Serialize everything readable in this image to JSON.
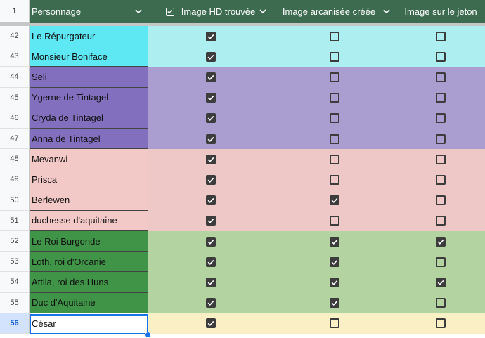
{
  "header": {
    "corner": "1",
    "columns": [
      {
        "label": "Personnage"
      },
      {
        "label": "Image HD trouvée"
      },
      {
        "label": "Image arcanisée créée"
      },
      {
        "label": "Image sur le jeton"
      }
    ]
  },
  "colors": {
    "header_bg": "#3d6b4f",
    "cyan": "#5ee8f3",
    "cyan_light": "#adeef1",
    "purple": "#8270bf",
    "purple_light": "#a99ecf",
    "pink": "#f3c9c8",
    "pink_light": "#eec8c7",
    "green": "#3f9447",
    "green_light": "#b3d3a0",
    "yellow": "#fff",
    "yellow_light": "#fbefc6"
  },
  "rows": [
    {
      "num": "42",
      "name": "Le Répurgateur",
      "group": "cyan",
      "hd": true,
      "arc": false,
      "jeton": false
    },
    {
      "num": "43",
      "name": "Monsieur Boniface",
      "group": "cyan",
      "hd": true,
      "arc": false,
      "jeton": false
    },
    {
      "num": "44",
      "name": "Seli",
      "group": "purple",
      "hd": true,
      "arc": false,
      "jeton": false
    },
    {
      "num": "45",
      "name": "Ygerne de Tintagel",
      "group": "purple",
      "hd": true,
      "arc": false,
      "jeton": false
    },
    {
      "num": "46",
      "name": "Cryda de Tintagel",
      "group": "purple",
      "hd": true,
      "arc": false,
      "jeton": false
    },
    {
      "num": "47",
      "name": "Anna de Tintagel",
      "group": "purple",
      "hd": true,
      "arc": false,
      "jeton": false
    },
    {
      "num": "48",
      "name": "Mevanwi",
      "group": "pink",
      "hd": true,
      "arc": false,
      "jeton": false
    },
    {
      "num": "49",
      "name": "Prisca",
      "group": "pink",
      "hd": true,
      "arc": false,
      "jeton": false
    },
    {
      "num": "50",
      "name": "Berlewen",
      "group": "pink",
      "hd": true,
      "arc": true,
      "jeton": false
    },
    {
      "num": "51",
      "name": "duchesse d'aquitaine",
      "group": "pink",
      "hd": true,
      "arc": false,
      "jeton": false
    },
    {
      "num": "52",
      "name": "Le Roi Burgonde",
      "group": "green",
      "hd": true,
      "arc": true,
      "jeton": true
    },
    {
      "num": "53",
      "name": "Loth, roi d'Orcanie",
      "group": "green",
      "hd": true,
      "arc": true,
      "jeton": false
    },
    {
      "num": "54",
      "name": "Attila, roi des Huns",
      "group": "green",
      "hd": true,
      "arc": true,
      "jeton": true
    },
    {
      "num": "55",
      "name": "Duc d'Aquitaine",
      "group": "green",
      "hd": true,
      "arc": true,
      "jeton": false
    },
    {
      "num": "56",
      "name": "César",
      "group": "yellow",
      "hd": true,
      "arc": false,
      "jeton": false
    }
  ]
}
